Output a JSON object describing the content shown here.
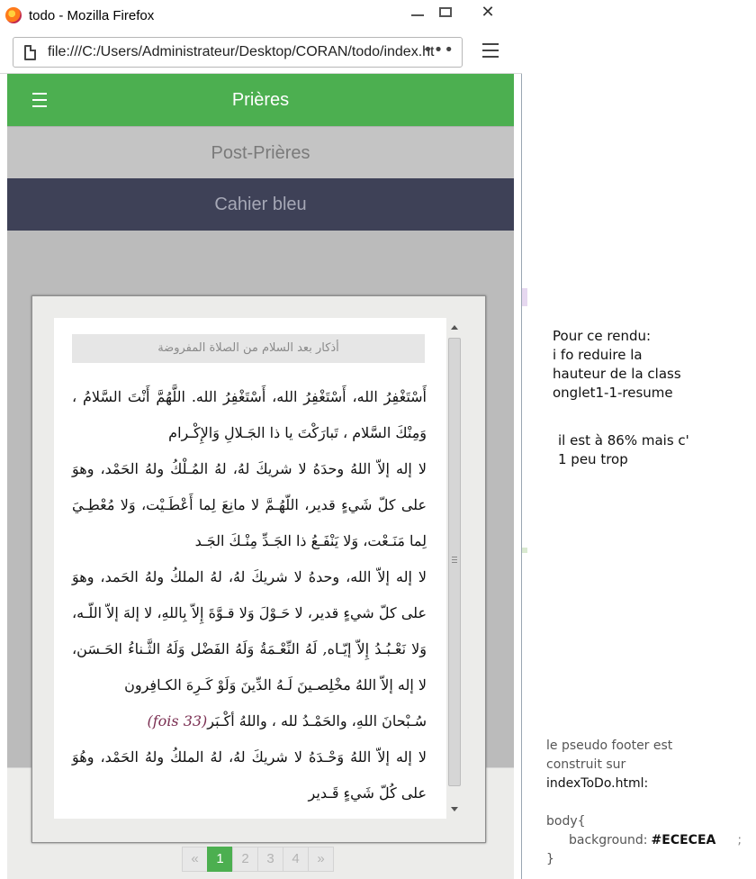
{
  "window": {
    "title": "todo - Mozilla Firefox",
    "url": "file:///C:/Users/Administrateur/Desktop/CORAN/todo/index.html",
    "close_glyph": "✕"
  },
  "app": {
    "tabs": [
      {
        "label": "Prières"
      },
      {
        "label": "Post-Prières"
      },
      {
        "label": "Cahier bleu"
      }
    ],
    "section_title": "أذكار بعد السلام من الصلاة المفروضة",
    "paragraphs": [
      "أَسْتَغْفِرُ الله، أَسْتَغْفِرُ الله، أَسْتَغْفِرُ الله. اللَّهُمَّ أَنْتَ السَّلامُ ، وَمِنْكَ السَّلام ، تَبارَكْتَ يا ذا الجَـلالِ وَالإِكْـرام",
      "لا إله إلاّ اللهُ وحدَهُ لا شريكَ لهُ، لهُ المُـلْكُ ولهُ الحَمْد، وهوَ على كلّ شَيءٍ قدير، اللّهُـمَّ لا مانِعَ لِما أَعْطَـيْت، وَلا مُعْطِـيَ لِما مَنَـعْت، وَلا يَنْفَـعُ ذا الجَـدِّ مِنْـكَ الجَـد",
      "لا إله إلاّ الله، وحدهُ لا شريكَ لهُ، لهُ الملكُ ولهُ الحَمد، وهوَ على كلّ شيءٍ قدير، لا حَـوْلَ وَلا قـوَّةَ إِلاّ بِاللهِ، لا إلهَ إلاّ اللّـه، وَلا نَعْـبُـدُ إِلاّ إيّـاه, لَهُ النِّعْـمَةُ وَلَهُ الفَضْل وَلَهُ الثَّـناءُ الحَـسَن، لا إله إلاّ اللهُ مخْلِصـينَ لَـهُ الدِّينَ وَلَوْ كَـرِهَ الكـافِرون"
    ],
    "tasbih": {
      "text": "سُـبْحانَ اللهِ، والحَمْـدُ لله ، واللهُ أكْـبَر",
      "count": "(33 fois)"
    },
    "last_paragraph": "لا إله إلاّ اللهُ وَحْـدَهُ لا شريكَ لهُ، لهُ الملكُ ولهُ الحَمْد، وهُوَ على كُلّ شَيءٍ قَـدير",
    "pagination": {
      "prev": "«",
      "pages": [
        "1",
        "2",
        "3",
        "4"
      ],
      "next": "»",
      "active": 1
    }
  },
  "notes": {
    "note1_lines": [
      "Pour ce rendu:",
      "i fo reduire la",
      "hauteur de la class",
      "onglet1-1-resume"
    ],
    "note2_lines": [
      "il est à 86% mais c'",
      "1 peu trop"
    ],
    "note3_line1": "le pseudo  footer est",
    "note3_line2": "construit sur",
    "note3_line3": "indexToDo.html:",
    "code_line1": "body{",
    "code_prop": "background:",
    "code_value": "#ECECEA",
    "code_semi": ";",
    "code_close": "}"
  },
  "colors": {
    "tab_active": "#4caf50",
    "tab_grey": "#c4c4c4",
    "tab_dark": "#3e4157",
    "footer_bg": "#ECECEA",
    "count_note": "#7b2f52"
  }
}
